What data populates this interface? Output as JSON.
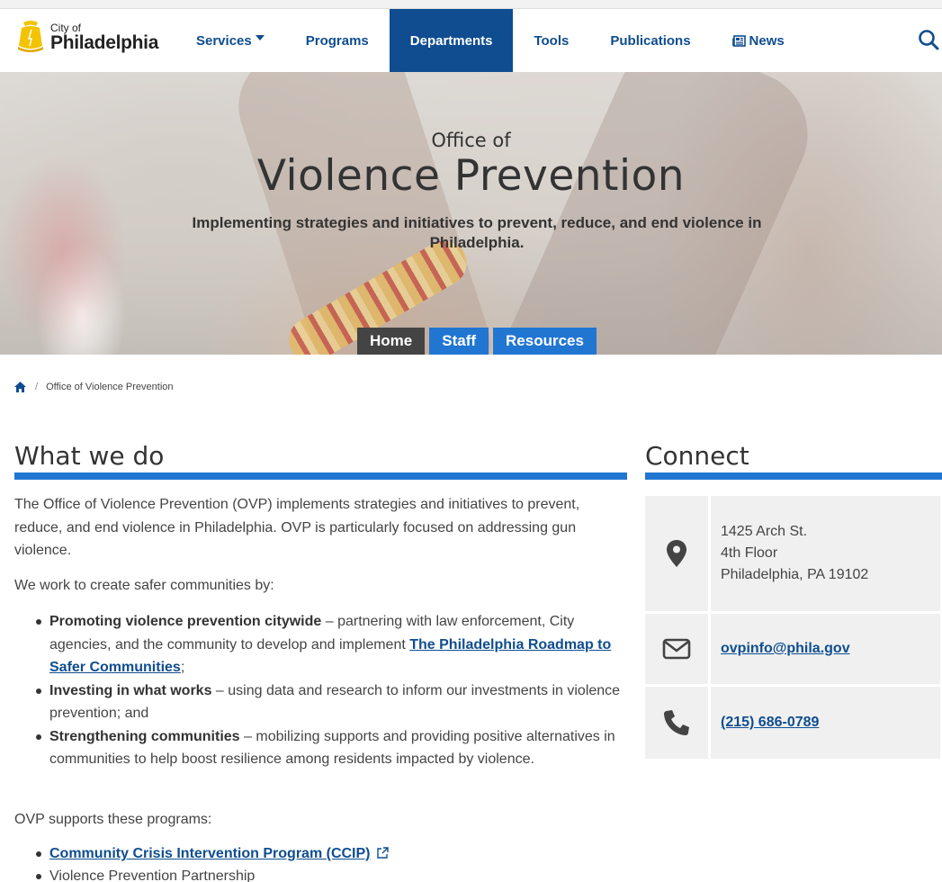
{
  "brand": {
    "city": "City of",
    "name": "Philadelphia"
  },
  "nav": {
    "items": [
      "Services",
      "Programs",
      "Departments",
      "Tools",
      "Publications",
      "News"
    ],
    "active": "Departments"
  },
  "hero": {
    "office": "Office of",
    "title": "Violence Prevention",
    "subtitle": "Implementing strategies and initiatives to prevent, reduce, and end violence in Philadelphia."
  },
  "tabs": {
    "home": "Home",
    "staff": "Staff",
    "resources": "Resources"
  },
  "breadcrumb": {
    "current": "Office of Violence Prevention"
  },
  "main": {
    "heading": "What we do",
    "intro": "The Office of Violence Prevention (OVP) implements strategies and initiatives to prevent, reduce, and end violence in Philadelphia. OVP is particularly focused on addressing gun violence.",
    "lead": "We work to create safer communities by:",
    "items": [
      {
        "bold": "Promoting violence prevention citywide",
        "text": " – partnering with law enforcement, City agencies, and the community to develop and implement ",
        "link": "The Philadelphia Roadmap to Safer Communities",
        "after": ";"
      },
      {
        "bold": "Investing in what works",
        "text": " – using data and research to inform our investments in violence prevention; and"
      },
      {
        "bold": "Strengthening communities",
        "text": " – mobilizing supports and providing positive alternatives in communities to help boost resilience among residents impacted by violence."
      }
    ],
    "programs_lead": "OVP supports these programs:",
    "programs": [
      {
        "label": "Community Crisis Intervention Program (CCIP)",
        "external": true
      },
      {
        "label": "Violence Prevention Partnership",
        "external": false
      }
    ]
  },
  "connect": {
    "heading": "Connect",
    "address": [
      "1425 Arch St.",
      "4th Floor",
      "Philadelphia, PA 19102"
    ],
    "email": "ovpinfo@phila.gov",
    "phone": "(215) 686-0789"
  },
  "colors": {
    "brand_blue": "#0f4d90",
    "accent_blue": "#2176d2",
    "active_tab": "#444444"
  }
}
